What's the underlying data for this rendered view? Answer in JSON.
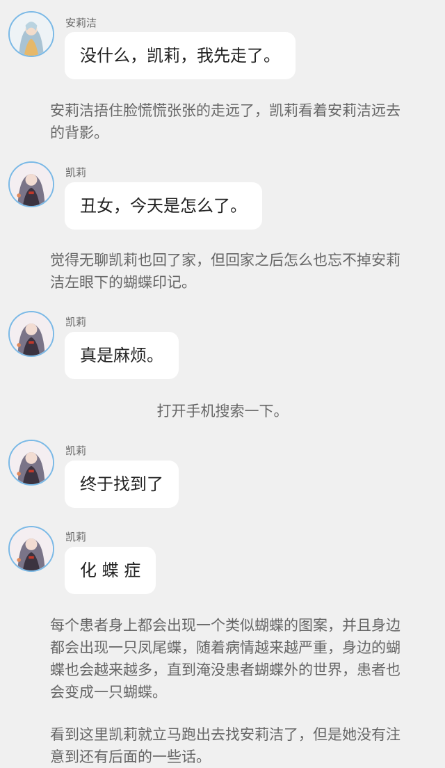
{
  "messages": [
    {
      "speaker": "安莉洁",
      "text": "没什么，凯莉，我先走了。",
      "avatar": "anliejie-avatar"
    },
    {
      "speaker": "凯莉",
      "text": "丑女，今天是怎么了。",
      "avatar": "kaili-avatar"
    },
    {
      "speaker": "凯莉",
      "text": "真是麻烦。",
      "avatar": "kaili-avatar"
    },
    {
      "speaker": "凯莉",
      "text": "终于找到了",
      "avatar": "kaili-avatar"
    },
    {
      "speaker": "凯莉",
      "text": "化 蝶 症",
      "avatar": "kaili-avatar"
    }
  ],
  "narrations": [
    "安莉洁捂住脸慌慌张张的走远了，凯莉看着安莉洁远去的背影。",
    "觉得无聊凯莉也回了家，但回家之后怎么也忘不掉安莉洁左眼下的蝴蝶印记。",
    "打开手机搜索一下。",
    "每个患者身上都会出现一个类似蝴蝶的图案，并且身边都会出现一只凤尾蝶，随着病情越来越严重，身边的蝴蝶也会越来越多，直到淹没患者蝴蝶外的世界，患者也会变成一只蝴蝶。",
    "看到这里凯莉就立马跑出去找安莉洁了，但是她没有注意到还有后面的一些话。"
  ]
}
